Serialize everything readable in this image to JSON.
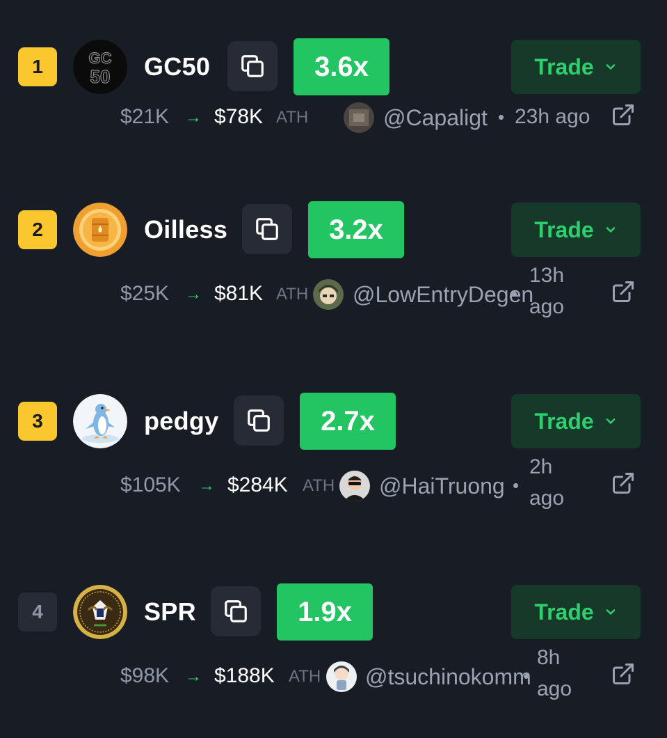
{
  "tokens": [
    {
      "rank": "1",
      "name": "GC50",
      "multiplier": "3.6x",
      "trade_label": "Trade",
      "price_from": "$21K",
      "arrow": "→",
      "price_to": "$78K",
      "ath_label": "ATH",
      "handle": "@Capaligt",
      "dot": "•",
      "time": "23h ago",
      "avatar_icon": "gc50-logo",
      "user_icon": "user-photo"
    },
    {
      "rank": "2",
      "name": "Oilless",
      "multiplier": "3.2x",
      "trade_label": "Trade",
      "price_from": "$25K",
      "arrow": "→",
      "price_to": "$81K",
      "ath_label": "ATH",
      "handle": "@LowEntryDegen",
      "dot": "•",
      "time_line1": "13h",
      "time_line2": "ago",
      "avatar_icon": "oil-barrel-logo",
      "user_icon": "user-anime-avatar"
    },
    {
      "rank": "3",
      "name": "pedgy",
      "multiplier": "2.7x",
      "trade_label": "Trade",
      "price_from": "$105K",
      "arrow": "→",
      "price_to": "$284K",
      "ath_label": "ATH",
      "handle": "@HaiTruong",
      "dot": "•",
      "time_line1": "2h",
      "time_line2": "ago",
      "avatar_icon": "penguin-logo",
      "user_icon": "user-sunglasses-avatar"
    },
    {
      "rank": "4",
      "name": "SPR",
      "multiplier": "1.9x",
      "trade_label": "Trade",
      "price_from": "$98K",
      "arrow": "→",
      "price_to": "$188K",
      "ath_label": "ATH",
      "handle": "@tsuchinokomm",
      "dot": "•",
      "time_line1": "8h",
      "time_line2": "ago",
      "avatar_icon": "seal-logo",
      "user_icon": "user-chibi-avatar"
    }
  ],
  "colors": {
    "background": "#181c24",
    "rank_gold": "#fac72f",
    "multiplier_green": "#23c563",
    "trade_bg": "#17392a",
    "trade_text": "#2ecf6d"
  }
}
